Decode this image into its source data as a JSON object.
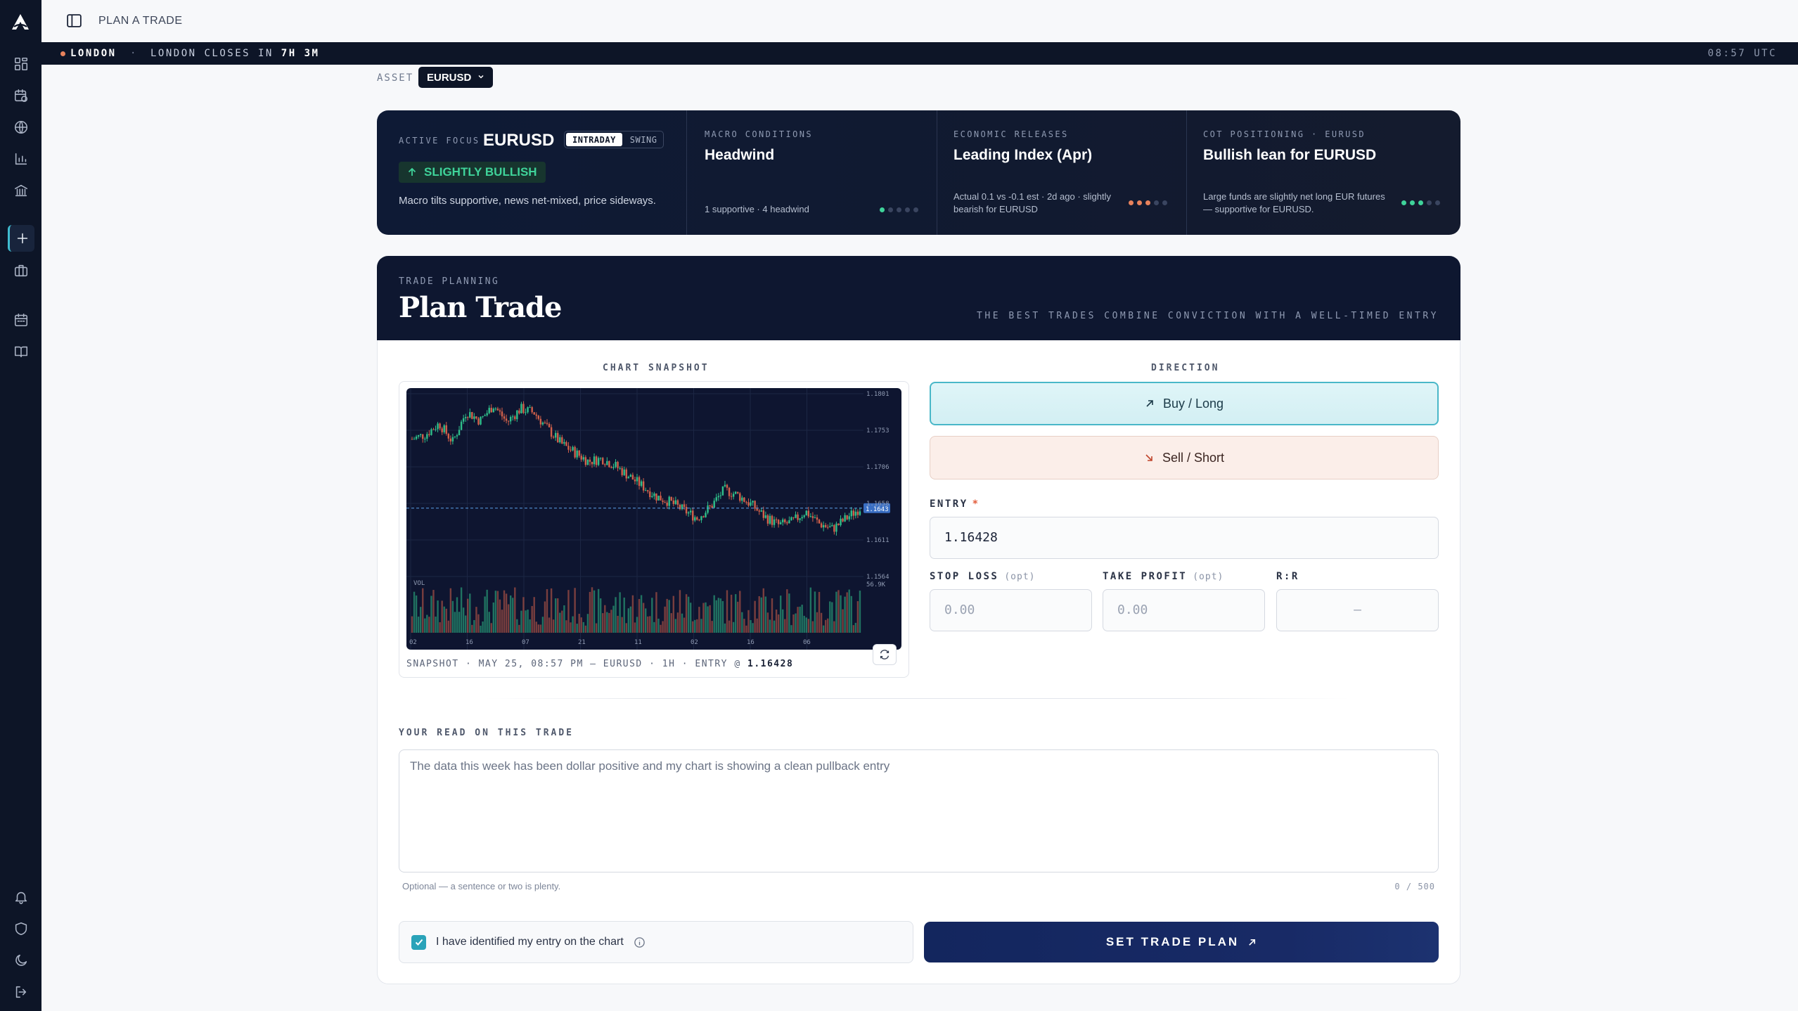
{
  "topbar": {
    "breadcrumb": "PLAN A TRADE"
  },
  "session": {
    "city": "LONDON",
    "separator": "·",
    "closes_prefix": "LONDON CLOSES IN",
    "closes_time": "7H 3M",
    "clock": "08:57 UTC"
  },
  "asset": {
    "label": "ASSET",
    "selected": "EURUSD"
  },
  "focus": {
    "active": {
      "kicker": "ACTIVE FOCUS",
      "symbol": "EURUSD",
      "modes": [
        "INTRADAY",
        "SWING"
      ],
      "selected_mode": "INTRADAY",
      "bias": "SLIGHTLY BULLISH",
      "summary": "Macro tilts supportive, news net-mixed, price sideways."
    },
    "macro": {
      "kicker": "MACRO CONDITIONS",
      "title": "Headwind",
      "detail": "1 supportive · 4 headwind",
      "dots": [
        "#3fd39a",
        "#3a4560",
        "#3a4560",
        "#3a4560",
        "#3a4560"
      ]
    },
    "economic": {
      "kicker": "ECONOMIC RELEASES",
      "title": "Leading Index (Apr)",
      "detail": "Actual 0.1 vs -0.1 est · 2d ago · slightly bearish for EURUSD",
      "dots": [
        "#e8825c",
        "#e8825c",
        "#e8825c",
        "#3a4560",
        "#3a4560"
      ]
    },
    "cot": {
      "kicker": "COT POSITIONING · EURUSD",
      "title": "Bullish lean for EURUSD",
      "detail": "Large funds are slightly net long EUR futures — supportive for EURUSD.",
      "dots": [
        "#3fd39a",
        "#3fd39a",
        "#3fd39a",
        "#3a4560",
        "#3a4560"
      ]
    }
  },
  "plan": {
    "kicker": "TRADE PLANNING",
    "title": "Plan Trade",
    "motto": "THE BEST TRADES COMBINE CONVICTION WITH A WELL-TIMED ENTRY"
  },
  "chart_section": {
    "label": "CHART SNAPSHOT",
    "caption_prefix": "SNAPSHOT · MAY 25, 08:57 PM — EURUSD · 1H · ENTRY @",
    "caption_entry": "1.16428",
    "y_ticks": [
      "1.1801",
      "1.1753",
      "1.1706",
      "1.1658",
      "1.1611",
      "1.1564"
    ],
    "price_marker": "1.1643",
    "vol_label": "VOL",
    "vol_value": "56.9K",
    "x_ticks": [
      "02",
      "16",
      "07",
      "21",
      "11",
      "02",
      "16",
      "06"
    ]
  },
  "chart_data": {
    "type": "line",
    "title": "",
    "ylim": [
      1.155,
      1.181
    ],
    "entry_line": 1.16428,
    "close": [
      1.1745,
      1.1752,
      1.1768,
      1.1741,
      1.1786,
      1.1772,
      1.1795,
      1.177,
      1.179,
      1.1784,
      1.176,
      1.1738,
      1.1725,
      1.1712,
      1.1716,
      1.1705,
      1.169,
      1.1675,
      1.166,
      1.1652,
      1.164,
      1.1628,
      1.1645,
      1.167,
      1.1662,
      1.1648,
      1.163,
      1.1618,
      1.1622,
      1.1638,
      1.162,
      1.1612,
      1.1628,
      1.1643
    ]
  },
  "direction": {
    "label": "DIRECTION",
    "buy": "Buy / Long",
    "sell": "Sell / Short",
    "selected": "Buy / Long"
  },
  "entry": {
    "label": "ENTRY",
    "required_mark": "*",
    "value": "1.16428"
  },
  "stop_loss": {
    "label": "STOP LOSS",
    "opt": "(opt)",
    "placeholder": "0.00"
  },
  "take_profit": {
    "label": "TAKE PROFIT",
    "opt": "(opt)",
    "placeholder": "0.00"
  },
  "rr": {
    "label": "R:R",
    "value": "—"
  },
  "read": {
    "label": "YOUR READ ON THIS TRADE",
    "value": "The data this week has been dollar positive and my chart is showing a clean pullback entry",
    "hint": "Optional — a sentence or two is plenty.",
    "counter": "0 / 500"
  },
  "confirm": {
    "label": "I have identified my entry on the chart",
    "checked": true
  },
  "submit": {
    "label": "SET TRADE PLAN"
  }
}
